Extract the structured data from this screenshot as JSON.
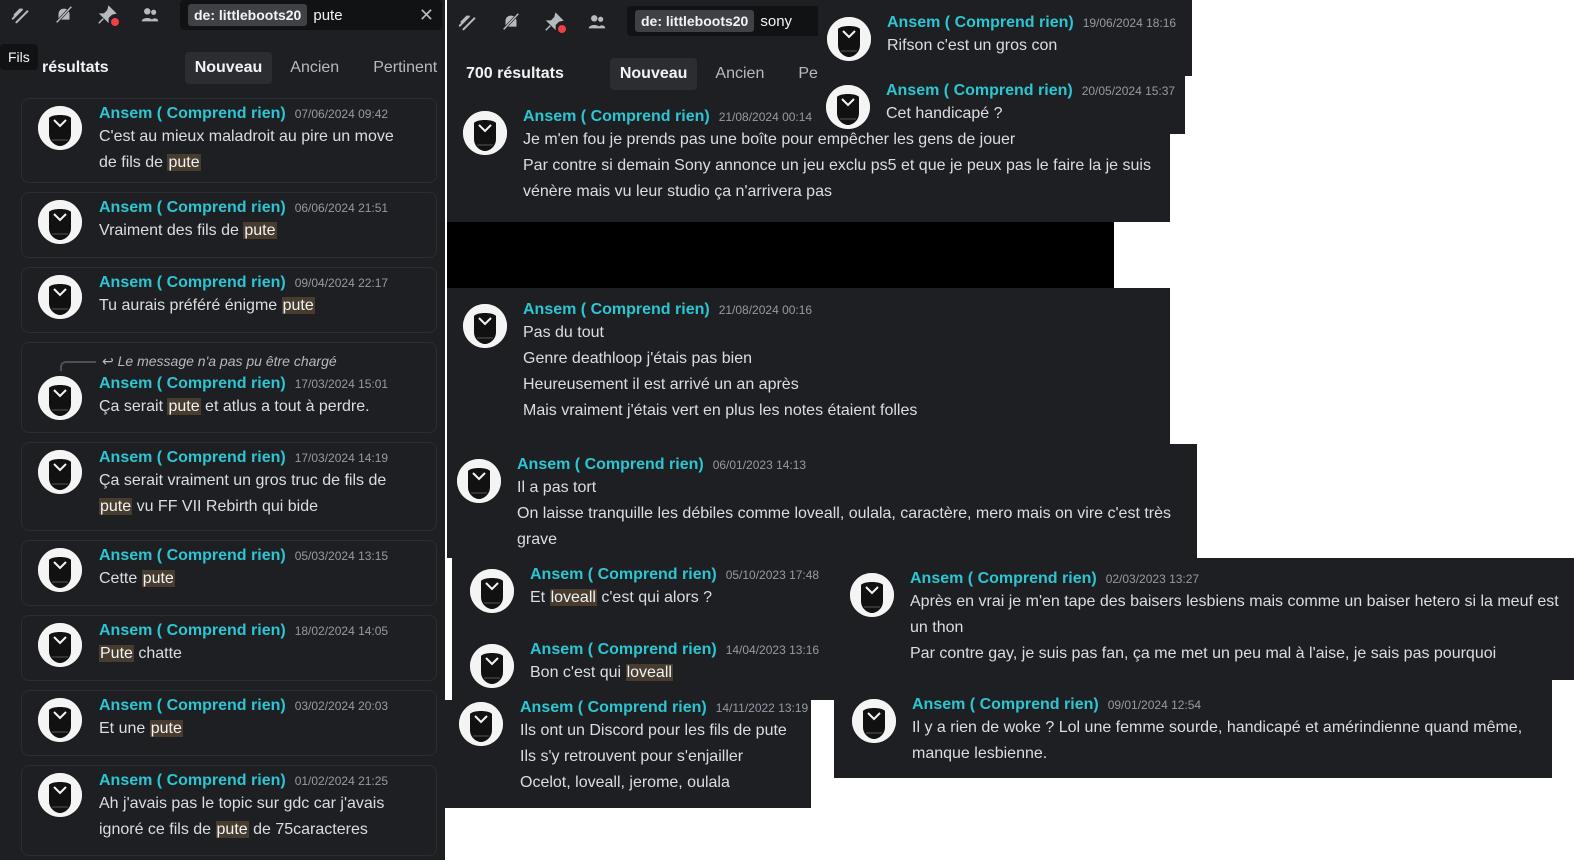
{
  "tooltip": "Fils",
  "left": {
    "search": {
      "filter": "de: littleboots20",
      "term": "pute"
    },
    "results_label": "résultats",
    "tabs": [
      "Nouveau",
      "Ancien",
      "Pertinent"
    ],
    "reply_unavailable": "Le message n'a pas pu être chargé",
    "messages": [
      {
        "author": "Ansem ( Comprend rien)",
        "ts": "07/06/2024 09:42",
        "lines": [
          [
            {
              "t": "C'est au mieux maladroit au pire un move"
            }
          ],
          [
            {
              "t": "de fils de "
            },
            {
              "t": "pute",
              "hl": true
            }
          ]
        ]
      },
      {
        "author": "Ansem ( Comprend rien)",
        "ts": "06/06/2024 21:51",
        "lines": [
          [
            {
              "t": "Vraiment des fils de "
            },
            {
              "t": "pute",
              "hl": true
            }
          ]
        ]
      },
      {
        "author": "Ansem ( Comprend rien)",
        "ts": "09/04/2024 22:17",
        "lines": [
          [
            {
              "t": "Tu aurais préféré énigme "
            },
            {
              "t": "pute",
              "hl": true
            }
          ]
        ]
      },
      {
        "author": "Ansem ( Comprend rien)",
        "ts": "17/03/2024 15:01",
        "lines": [
          [
            {
              "t": "Ça serait "
            },
            {
              "t": "pute",
              "hl": true
            },
            {
              "t": " et atlus a tout à perdre."
            }
          ]
        ]
      },
      {
        "author": "Ansem ( Comprend rien)",
        "ts": "17/03/2024 14:19",
        "lines": [
          [
            {
              "t": "Ça serait vraiment un gros truc de fils de"
            }
          ],
          [
            {
              "t": "pute",
              "hl": true
            },
            {
              "t": " vu FF VII Rebirth qui bide"
            }
          ]
        ]
      },
      {
        "author": "Ansem ( Comprend rien)",
        "ts": "05/03/2024 13:15",
        "lines": [
          [
            {
              "t": "Cette "
            },
            {
              "t": "pute",
              "hl": true
            }
          ]
        ]
      },
      {
        "author": "Ansem ( Comprend rien)",
        "ts": "18/02/2024 14:05",
        "lines": [
          [
            {
              "t": "Pute",
              "hl": true
            },
            {
              "t": " chatte"
            }
          ]
        ]
      },
      {
        "author": "Ansem ( Comprend rien)",
        "ts": "03/02/2024 20:03",
        "lines": [
          [
            {
              "t": "Et une "
            },
            {
              "t": "pute",
              "hl": true
            }
          ]
        ]
      },
      {
        "author": "Ansem ( Comprend rien)",
        "ts": "01/02/2024 21:25",
        "lines": [
          [
            {
              "t": "Ah j'avais pas le topic sur gdc car j'avais"
            }
          ],
          [
            {
              "t": "ignoré ce fils de "
            },
            {
              "t": "pute",
              "hl": true
            },
            {
              "t": " de 75caracteres"
            }
          ]
        ]
      }
    ]
  },
  "middle": {
    "search": {
      "filter": "de: littleboots20",
      "term": "sony"
    },
    "results_label": "700 résultats",
    "tabs": [
      "Nouveau",
      "Ancien",
      "Pe"
    ],
    "messages": [
      {
        "author": "Ansem ( Comprend rien)",
        "ts": "21/08/2024 00:14",
        "lines": [
          [
            {
              "t": "Je m'en fou je prends pas une boîte pour empêcher les gens de jouer"
            }
          ],
          [
            {
              "t": "Par contre si demain Sony annonce un jeu exclu ps5 et que je peux pas le faire la je suis"
            }
          ],
          [
            {
              "t": "vénère mais vu leur studio ça n'arrivera pas"
            }
          ]
        ]
      },
      {
        "author": "Ansem ( Comprend rien)",
        "ts": "21/08/2024 00:16",
        "lines": [
          [
            {
              "t": "Pas du tout"
            }
          ],
          [
            {
              "t": "Genre deathloop j'étais pas bien"
            }
          ],
          [
            {
              "t": "Heureusement il est arrivé un an après"
            }
          ],
          [
            {
              "t": "Mais vraiment j'étais vert en plus les notes étaient folles"
            }
          ]
        ]
      }
    ]
  },
  "snippets": [
    {
      "author": "Ansem ( Comprend rien)",
      "ts": "19/06/2024 18:16",
      "lines": [
        [
          {
            "t": "Rifson c'est un gros con"
          }
        ]
      ]
    },
    {
      "author": "Ansem ( Comprend rien)",
      "ts": "20/05/2024 15:37",
      "lines": [
        [
          {
            "t": "Cet handicapé ?"
          }
        ]
      ]
    },
    {
      "author": "Ansem ( Comprend rien)",
      "ts": "06/01/2023 14:13",
      "lines": [
        [
          {
            "t": "Il a pas tort"
          }
        ],
        [
          {
            "t": "On laisse tranquille les débiles comme loveall, oulala, caractère, mero mais on vire c'est très"
          }
        ],
        [
          {
            "t": "grave"
          }
        ]
      ]
    },
    {
      "author": "Ansem ( Comprend rien)",
      "ts": "05/10/2023 17:48",
      "lines": [
        [
          {
            "t": "Et "
          },
          {
            "t": "loveall",
            "hl": true
          },
          {
            "t": " c'est qui alors ?"
          }
        ]
      ]
    },
    {
      "author": "Ansem ( Comprend rien)",
      "ts": "14/04/2023 13:16",
      "lines": [
        [
          {
            "t": "Bon c'est qui "
          },
          {
            "t": "loveall",
            "hl": true
          }
        ]
      ]
    },
    {
      "author": "Ansem ( Comprend rien)",
      "ts": "14/11/2022 13:19",
      "lines": [
        [
          {
            "t": "Ils ont un Discord pour les fils de pute"
          }
        ],
        [
          {
            "t": "Ils s'y retrouvent pour s'enjailler"
          }
        ],
        [
          {
            "t": "Ocelot, loveall, jerome, oulala"
          }
        ]
      ]
    },
    {
      "author": "Ansem ( Comprend rien)",
      "ts": "02/03/2023 13:27",
      "lines": [
        [
          {
            "t": "Après en vrai je m'en tape des baisers lesbiens mais comme un baiser hetero si la meuf est"
          }
        ],
        [
          {
            "t": "un thon"
          }
        ],
        [
          {
            "t": "Par contre gay, je suis pas fan, ça me met un peu mal à l'aise, je sais pas pourquoi"
          }
        ]
      ]
    },
    {
      "author": "Ansem ( Comprend rien)",
      "ts": "09/01/2024 12:54",
      "lines": [
        [
          {
            "t": "Il y a rien de woke ? Lol une femme sourde, handicapé et amérindienne quand même,"
          }
        ],
        [
          {
            "t": "manque lesbienne."
          }
        ]
      ]
    }
  ]
}
